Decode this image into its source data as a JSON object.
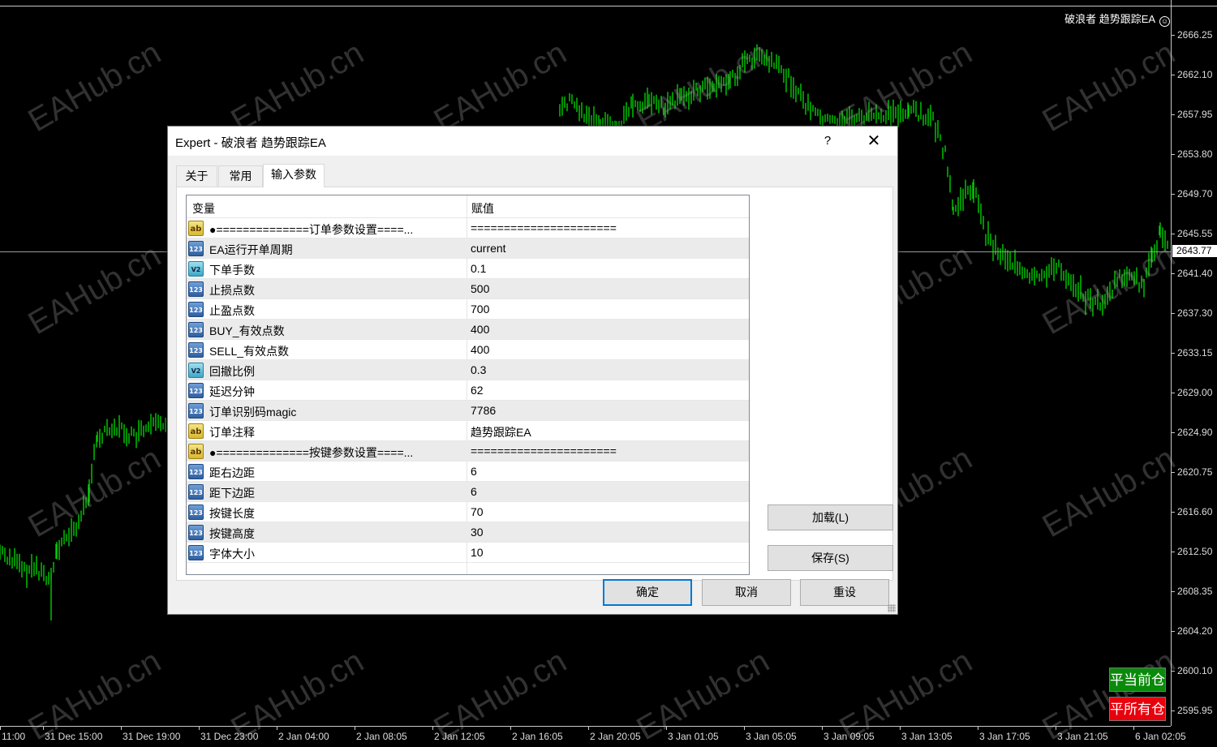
{
  "chart": {
    "ea_label": "破浪者 趋势跟踪EA",
    "smile_icon": "smile-icon",
    "price_labels": [
      "2666.25",
      "2662.10",
      "2657.95",
      "2653.80",
      "2649.70",
      "2645.55",
      "2641.40",
      "2637.30",
      "2633.15",
      "2629.00",
      "2624.90",
      "2620.75",
      "2616.60",
      "2612.50",
      "2608.35",
      "2604.20",
      "2600.10",
      "2595.95"
    ],
    "current_price": "2643.77",
    "time_labels": [
      "11:00",
      "31 Dec 15:00",
      "31 Dec 19:00",
      "31 Dec 23:00",
      "2 Jan 04:00",
      "2 Jan 08:05",
      "2 Jan 12:05",
      "2 Jan 16:05",
      "2 Jan 20:05",
      "3 Jan 01:05",
      "3 Jan 05:05",
      "3 Jan 09:05",
      "3 Jan 13:05",
      "3 Jan 17:05",
      "3 Jan 21:05",
      "6 Jan 02:05"
    ],
    "buttons": {
      "close_current": "平当前仓",
      "close_all": "平所有仓"
    },
    "watermark": "EAHub.cn",
    "colors": {
      "background": "#000000",
      "candles": "#00dd00",
      "close_current_bg": "#0a8a0a",
      "close_all_bg": "#e8000c"
    }
  },
  "dialog": {
    "title": "Expert - 破浪者 趋势跟踪EA",
    "help": "?",
    "close": "✕",
    "tabs": [
      "关于",
      "常用",
      "输入参数"
    ],
    "active_tab": "输入参数",
    "grid": {
      "headers": {
        "variable": "变量",
        "value": "赋值"
      },
      "rows": [
        {
          "icon": "ab",
          "type": "string",
          "name": "●==============订单参数设置====...",
          "value": "======================"
        },
        {
          "icon": "123",
          "type": "int",
          "name": "EA运行开单周期",
          "value": "current"
        },
        {
          "icon": "V2",
          "type": "double",
          "name": "下单手数",
          "value": "0.1"
        },
        {
          "icon": "123",
          "type": "int",
          "name": "止损点数",
          "value": "500"
        },
        {
          "icon": "123",
          "type": "int",
          "name": "止盈点数",
          "value": "700"
        },
        {
          "icon": "123",
          "type": "int",
          "name": "BUY_有效点数",
          "value": "400"
        },
        {
          "icon": "123",
          "type": "int",
          "name": "SELL_有效点数",
          "value": "400"
        },
        {
          "icon": "V2",
          "type": "double",
          "name": "回撤比例",
          "value": "0.3"
        },
        {
          "icon": "123",
          "type": "int",
          "name": "延迟分钟",
          "value": "62"
        },
        {
          "icon": "123",
          "type": "int",
          "name": "订单识别码magic",
          "value": "7786"
        },
        {
          "icon": "ab",
          "type": "string",
          "name": "订单注释",
          "value": "趋势跟踪EA"
        },
        {
          "icon": "ab",
          "type": "string",
          "name": "●==============按键参数设置====...",
          "value": "======================"
        },
        {
          "icon": "123",
          "type": "int",
          "name": "距右边距",
          "value": "6"
        },
        {
          "icon": "123",
          "type": "int",
          "name": "距下边距",
          "value": "6"
        },
        {
          "icon": "123",
          "type": "int",
          "name": "按键长度",
          "value": "70"
        },
        {
          "icon": "123",
          "type": "int",
          "name": "按键高度",
          "value": "30"
        },
        {
          "icon": "123",
          "type": "int",
          "name": "字体大小",
          "value": "10"
        }
      ]
    },
    "buttons": {
      "load": "加载(L)",
      "save": "保存(S)",
      "ok": "确定",
      "cancel": "取消",
      "reset": "重设"
    }
  }
}
